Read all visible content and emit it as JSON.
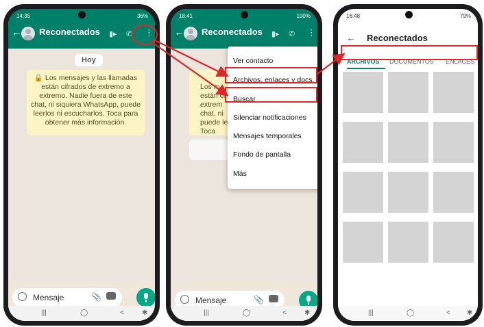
{
  "phone1": {
    "status_time": "14:35",
    "status_right": "36%",
    "contact_name": "Reconectados",
    "date_label": "Hoy",
    "encryption_notice": "Los mensajes y las llamadas están cifrados de extremo a extremo. Nadie fuera de este chat, ni siquiera WhatsApp, puede leerlos ni escucharlos. Toca para obtener más información.",
    "input_placeholder": "Mensaje"
  },
  "phone2": {
    "status_time": "18:41",
    "status_right": "100%",
    "contact_name": "Reconectados",
    "partial_text": "Los m\nestán ci\nextrem\nchat, ni\npuede le\nToca",
    "input_placeholder": "Mensaje",
    "menu": [
      "Ver contacto",
      "Archivos, enlaces y docs.",
      "Buscar",
      "Silenciar notificaciones",
      "Mensajes temporales",
      "Fondo de pantalla",
      "Más"
    ]
  },
  "phone3": {
    "status_time": "16:48",
    "status_right": "79%",
    "title": "Reconectados",
    "tabs": [
      "ARCHIVOS",
      "DOCUMENTOS",
      "ENLACES"
    ]
  },
  "colors": {
    "whatsapp_green": "#008069",
    "annotation_red": "#e0262a",
    "mic_green": "#00a884"
  }
}
